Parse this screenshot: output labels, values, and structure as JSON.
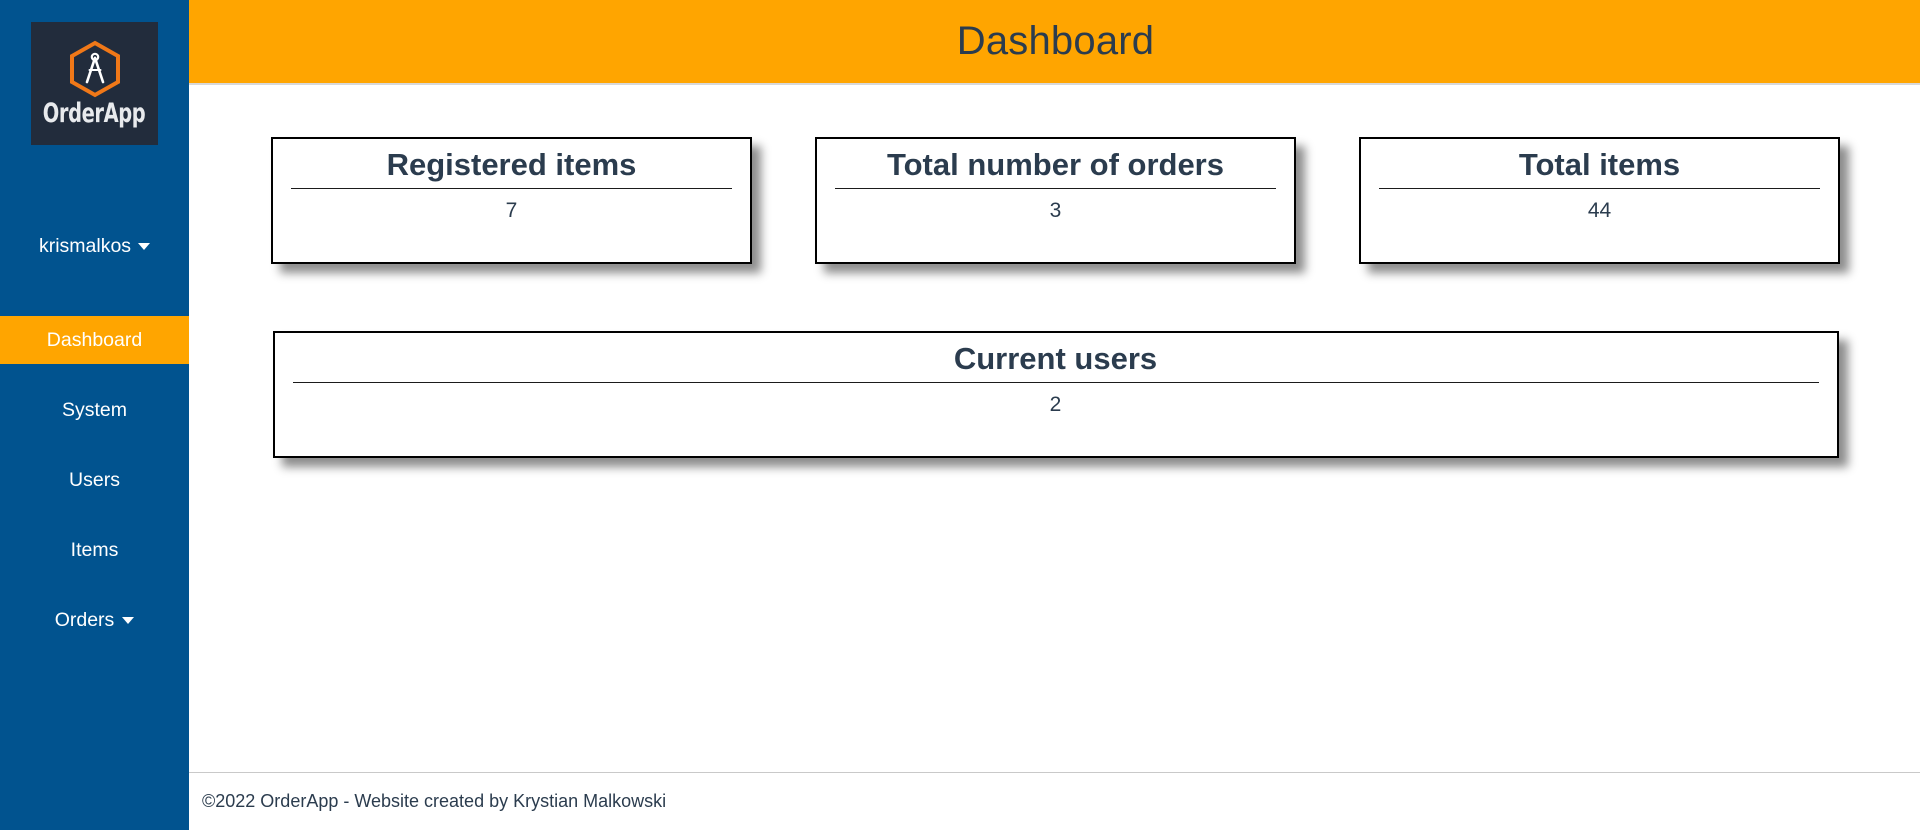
{
  "brand": {
    "name": "OrderApp",
    "logo_icon": "hexagon-compass-icon",
    "logo_bg": "#222c3c",
    "hex_color": "#f07818"
  },
  "sidebar": {
    "bg_color": "#01538f",
    "user": {
      "name": "krismalkos",
      "caret_icon": "chevron-down-icon"
    },
    "items": [
      {
        "label": "Dashboard",
        "active": true,
        "has_caret": false
      },
      {
        "label": "System",
        "active": false,
        "has_caret": false
      },
      {
        "label": "Users",
        "active": false,
        "has_caret": false
      },
      {
        "label": "Items",
        "active": false,
        "has_caret": false
      },
      {
        "label": "Orders",
        "active": false,
        "has_caret": true
      }
    ],
    "active_color": "#ffa500"
  },
  "header": {
    "title": "Dashboard",
    "bg_color": "#ffa500",
    "text_color": "#2b3c4e"
  },
  "main": {
    "stat_cards": [
      {
        "title": "Registered items",
        "value": "7"
      },
      {
        "title": "Total number of orders",
        "value": "3"
      },
      {
        "title": "Total items",
        "value": "44"
      }
    ],
    "wide_card": {
      "title": "Current users",
      "value": "2"
    }
  },
  "footer": {
    "text": "©2022 OrderApp - Website created by Krystian Malkowski"
  }
}
